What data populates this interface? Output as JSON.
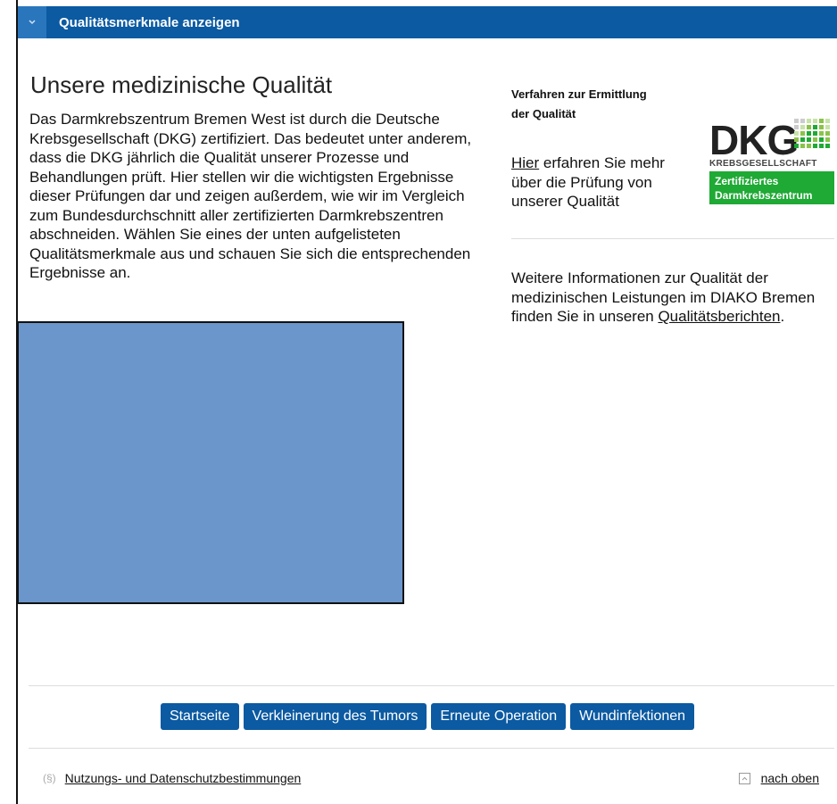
{
  "topbar": {
    "title": "Qualitätsmerkmale anzeigen",
    "toggle_icon": "chevron-down-icon"
  },
  "main": {
    "heading": "Unsere medizinische Qualität",
    "intro": "Das Darmkrebszentrum Bremen West ist durch die Deutsche Krebsgesellschaft (DKG) zertifiziert. Das bedeutet unter anderem, dass die DKG jährlich die Qualität unserer Prozesse und Behandlungen prüft. Hier stellen wir die wichtigsten Ergebnisse dieser Prüfungen dar und zeigen außerdem, wie wir im Vergleich zum Bundesdurchschnitt aller zertifizierten Darmkrebszentren abschneiden. Wählen Sie eines der unten aufgelisteten Qualitätsmerkmale aus und schauen Sie sich die entsprechenden Ergebnisse an."
  },
  "sidebar": {
    "heading_line1": "Verfahren zur Ermittlung",
    "heading_line2": "der Qualität",
    "link_hier": "Hier",
    "text_after_hier": " erfahren Sie mehr über die Prüfung von unserer Qualität",
    "logo": {
      "letters": "DKG",
      "subtitle": "KREBSGESELLSCHAFT",
      "badge_line1": "Zertifiziertes",
      "badge_line2": "Darmkrebszentrum",
      "green": "#1fa935"
    },
    "more_text": "Weitere Informationen zur Qualität der medizinischen Leistungen im DIAKO Bremen finden Sie in unseren ",
    "more_link": "Qualitätsberichten",
    "more_end": "."
  },
  "buttons": [
    "Startseite",
    "Verkleinerung des Tumors",
    "Erneute Operation",
    "Wundinfektionen"
  ],
  "footer": {
    "para_symbol": "(§)",
    "terms_link": "Nutzungs- und Datenschutzbestimmungen",
    "top_link": "nach oben",
    "top_icon": "arrow-up-icon"
  },
  "colors": {
    "primary": "#0b5aa2",
    "media_placeholder": "#6a96cb"
  }
}
